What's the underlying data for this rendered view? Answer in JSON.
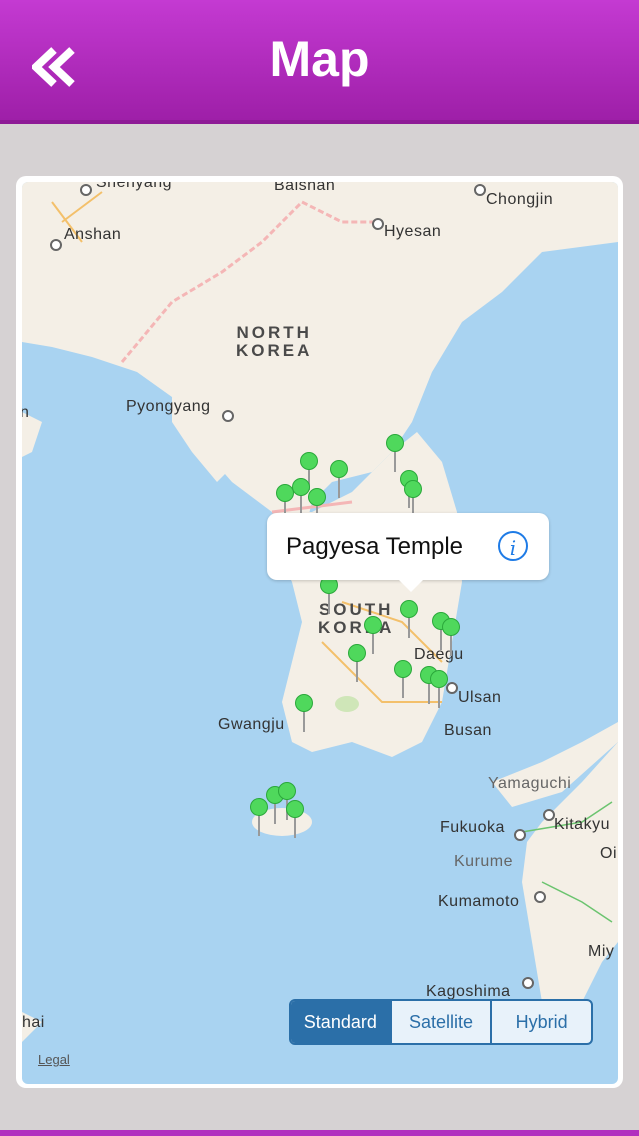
{
  "header": {
    "title": "Map",
    "back_icon": "double-chevron-left-icon",
    "color": "#b12ebe"
  },
  "map": {
    "labels": {
      "shenyang": "Shenyang",
      "baishan": "Baishan",
      "chongjin": "Chongjin",
      "anshan": "Anshan",
      "hyesan": "Hyesan",
      "north_korea_1": "NORTH",
      "north_korea_2": "KOREA",
      "pyongyang": "Pyongyang",
      "south_korea_1": "SOUTH",
      "south_korea_2": "KOREA",
      "daegu": "Daegu",
      "ulsan": "Ulsan",
      "gwangju": "Gwangju",
      "busan": "Busan",
      "yamaguchi": "Yamaguchi",
      "fukuoka": "Fukuoka",
      "kitakyu": "Kitakyu",
      "kurume": "Kurume",
      "oi": "Oi",
      "kumamoto": "Kumamoto",
      "miy": "Miy",
      "kagoshima": "Kagoshima",
      "hai": "hai",
      "n_edge": "n"
    },
    "callout": {
      "title": "Pagyesa Temple",
      "info_icon": "info-icon"
    },
    "legal": "Legal",
    "map_type": {
      "options": [
        "Standard",
        "Satellite",
        "Hybrid"
      ],
      "selected": "Standard"
    }
  }
}
